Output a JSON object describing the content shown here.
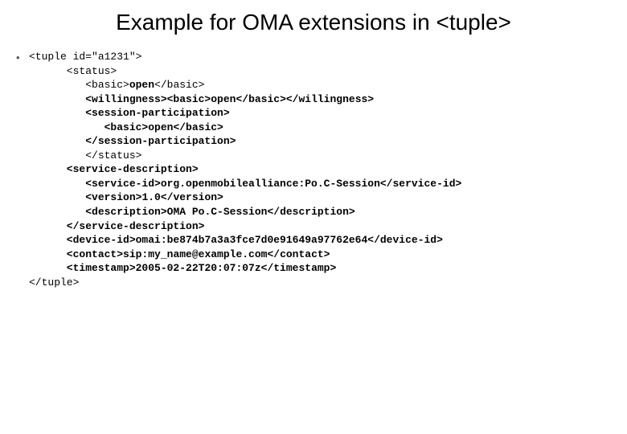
{
  "title": "Example for OMA extensions in <tuple>",
  "code": {
    "l01": "<tuple id=\"a1231\">",
    "l02": "      <status>",
    "l03a": "         <basic>",
    "l03b": "open",
    "l03c": "</basic>",
    "l04a": "         <willingness><basic>",
    "l04b": "open",
    "l04c": "</basic></willingness>",
    "l05": "         <session-participation>",
    "l06a": "            <basic>",
    "l06b": "open",
    "l06c": "</basic>",
    "l07": "         </session-participation>",
    "l08": "         </status>",
    "l09": "      <service-description>",
    "l10a": "         <service-id>",
    "l10b": "org.openmobilealliance:Po.C-Session",
    "l10c": "</service-id>",
    "l11a": "         <version>",
    "l11b": "1.0",
    "l11c": "</version>",
    "l12a": "         <description>",
    "l12b": "OMA Po.C-Session",
    "l12c": "</description>",
    "l13": "      </service-description>",
    "l14a": "      <device-id>",
    "l14b": "omai:be874b7a3a3fce7d0e91649a97762e64",
    "l14c": "</device-id>",
    "l15a": "      <contact>",
    "l15b": "sip:my_name@example.com",
    "l15c": "</contact>",
    "l16a": "      <timestamp>",
    "l16b": "2005-02-22T20:07:07z",
    "l16c": "</timestamp>",
    "l17": "</tuple>"
  }
}
